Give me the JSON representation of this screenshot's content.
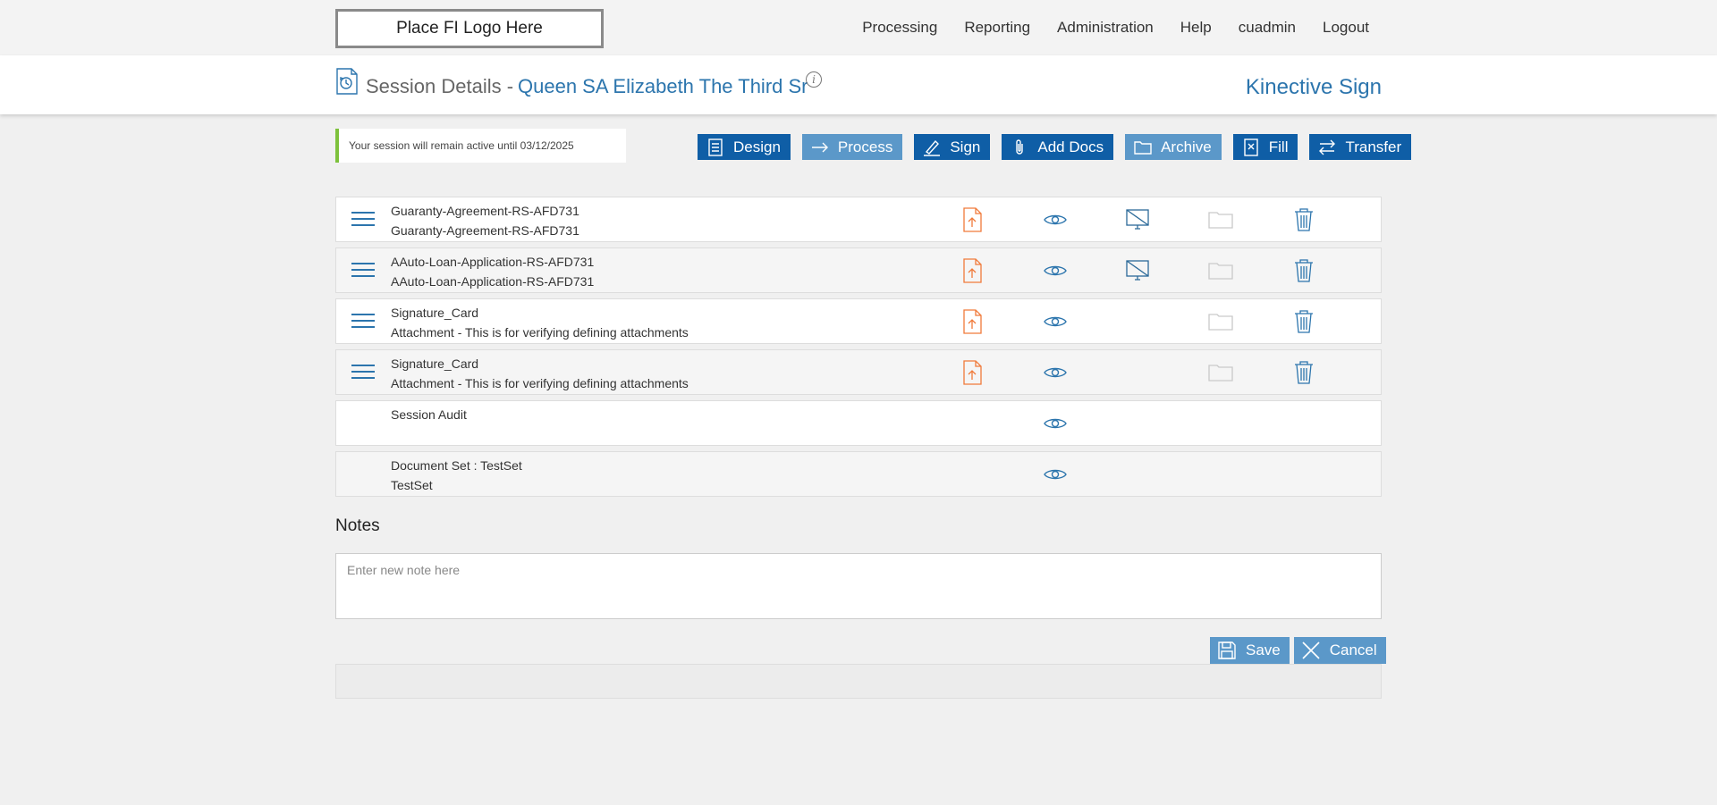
{
  "logo_text": "Place FI Logo Here",
  "nav": [
    "Processing",
    "Reporting",
    "Administration",
    "Help",
    "cuadmin",
    "Logout"
  ],
  "header": {
    "title": "Session Details -",
    "session_name": "Queen SA Elizabeth The Third Sr",
    "info_icon": "i",
    "brand": "Kinective Sign"
  },
  "notice": "Your session will remain active until 03/12/2025",
  "actions": {
    "design": "Design",
    "process": "Process",
    "sign": "Sign",
    "add_docs": "Add Docs",
    "archive": "Archive",
    "fill": "Fill",
    "transfer": "Transfer"
  },
  "documents": [
    {
      "line1": "Guaranty-Agreement-RS-AFD731",
      "line2": "Guaranty-Agreement-RS-AFD731"
    },
    {
      "line1": "AAuto-Loan-Application-RS-AFD731",
      "line2": "AAuto-Loan-Application-RS-AFD731"
    },
    {
      "line1": "Signature_Card",
      "line2": "Attachment - This is for verifying defining attachments"
    },
    {
      "line1": "Signature_Card",
      "line2": "Attachment - This is for verifying defining attachments"
    },
    {
      "line1": "Session Audit",
      "line2": ""
    },
    {
      "line1": "Document Set : TestSet",
      "line2": "TestSet"
    }
  ],
  "notes": {
    "label": "Notes",
    "placeholder": "Enter new note here",
    "save": "Save",
    "cancel": "Cancel"
  },
  "colors": {
    "primary": "#0f5ea6",
    "primary_light": "#5b98c9",
    "accent_text": "#2c75ad",
    "upload_icon": "#f07a3a",
    "notice_border": "#7dc13c"
  }
}
